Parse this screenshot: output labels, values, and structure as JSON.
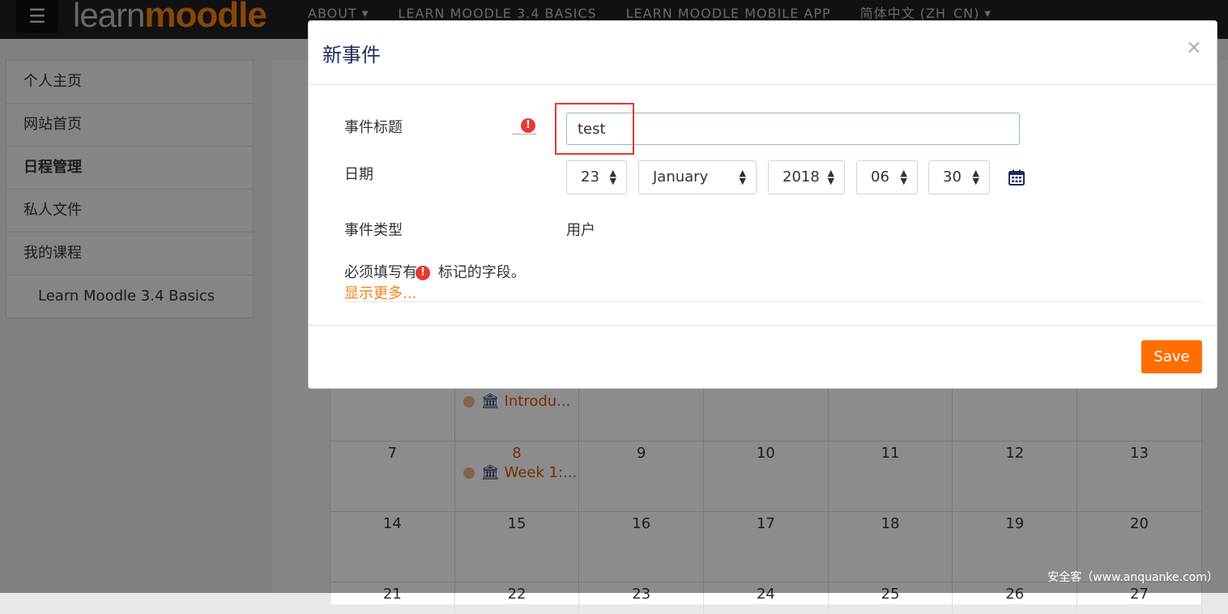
{
  "navbar": {
    "menu_icon": "hamburger-icon",
    "logo_learn": "learn",
    "logo_moodle": "moodle",
    "links": [
      {
        "label": "ABOUT",
        "dropdown": true
      },
      {
        "label": "LEARN MOODLE 3.4 BASICS",
        "dropdown": false
      },
      {
        "label": "LEARN MOODLE MOBILE APP",
        "dropdown": false
      },
      {
        "label": "简体中文 (ZH_CN)",
        "dropdown": true
      }
    ]
  },
  "sidebar": {
    "items": [
      {
        "label": "个人主页"
      },
      {
        "label": "网站首页"
      },
      {
        "label": "日程管理",
        "active": true
      },
      {
        "label": "私人文件"
      },
      {
        "label": "我的课程"
      },
      {
        "label": "Learn Moodle 3.4 Basics",
        "sub": true
      }
    ]
  },
  "calendar": {
    "rows": [
      [
        "",
        "",
        "",
        "",
        "",
        "",
        ""
      ],
      [
        "7",
        "8",
        "9",
        "10",
        "11",
        "12",
        "13"
      ],
      [
        "14",
        "15",
        "16",
        "17",
        "18",
        "19",
        "20"
      ],
      [
        "21",
        "22",
        "23",
        "24",
        "25",
        "26",
        "27"
      ]
    ],
    "today": "8",
    "events": [
      {
        "label": "Introdu..."
      },
      {
        "label": "Week 1:..."
      }
    ]
  },
  "modal": {
    "title": "新事件",
    "close": "×",
    "fields": {
      "title_label": "事件标题",
      "title_value": "test",
      "date_label": "日期",
      "day": "23",
      "month": "January",
      "year": "2018",
      "hour": "06",
      "minute": "30",
      "type_label": "事件类型",
      "type_value": "用户"
    },
    "required_note_before": "必须填写有",
    "required_note_after": " 标记的字段。",
    "show_more": "显示更多...",
    "save_label": "Save"
  },
  "watermark": "安全客（www.anquanke.com）",
  "colors": {
    "accent": "#f98012",
    "save_button": "#ff6e00",
    "required": "#e53935",
    "title": "#1d2b5e"
  }
}
